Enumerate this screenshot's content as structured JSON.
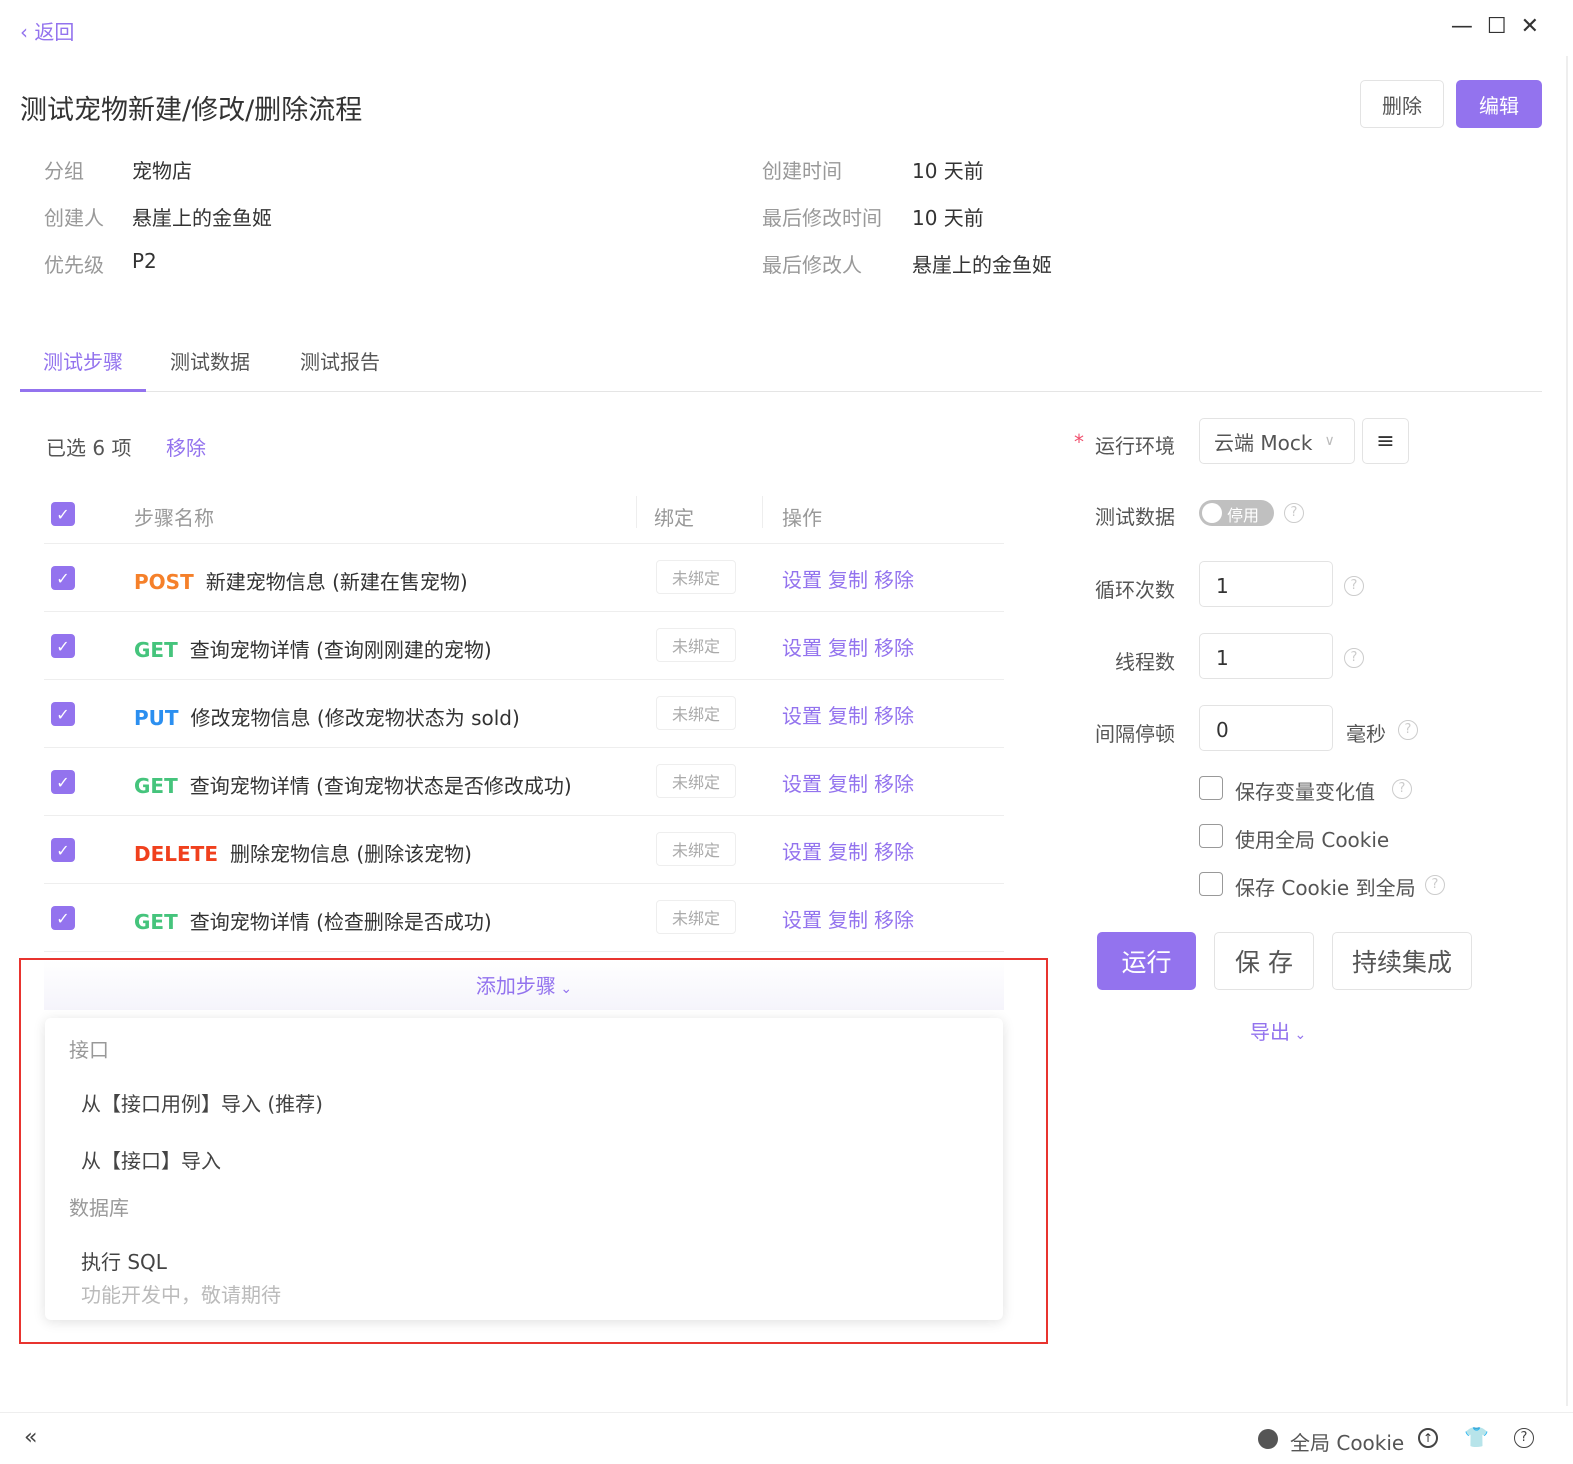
{
  "back_label": "返回",
  "title": "测试宠物新建/修改/删除流程",
  "header_buttons": {
    "delete": "删除",
    "edit": "编辑"
  },
  "meta": {
    "group_label": "分组",
    "group": "宠物店",
    "creator_label": "创建人",
    "creator": "悬崖上的金鱼姬",
    "priority_label": "优先级",
    "priority": "P2",
    "created_label": "创建时间",
    "created": "10 天前",
    "modified_label": "最后修改时间",
    "modified": "10 天前",
    "modifier_label": "最后修改人",
    "modifier": "悬崖上的金鱼姬"
  },
  "tabs": [
    "测试步骤",
    "测试数据",
    "测试报告"
  ],
  "selection": {
    "text": "已选 6 项",
    "remove": "移除"
  },
  "table": {
    "headers": [
      "步骤名称",
      "绑定",
      "操作"
    ],
    "ops": [
      "设置",
      "复制",
      "移除"
    ],
    "rows": [
      {
        "method": "POST",
        "color": "#f5802a",
        "name": "新建宠物信息 (新建在售宠物)",
        "bind": "未绑定"
      },
      {
        "method": "GET",
        "color": "#45c47c",
        "name": "查询宠物详情 (查询刚刚建的宠物)",
        "bind": "未绑定"
      },
      {
        "method": "PUT",
        "color": "#2b8ff0",
        "name": "修改宠物信息 (修改宠物状态为 sold)",
        "bind": "未绑定"
      },
      {
        "method": "GET",
        "color": "#45c47c",
        "name": "查询宠物详情 (查询宠物状态是否修改成功)",
        "bind": "未绑定"
      },
      {
        "method": "DELETE",
        "color": "#f0401d",
        "name": "删除宠物信息 (删除该宠物)",
        "bind": "未绑定"
      },
      {
        "method": "GET",
        "color": "#45c47c",
        "name": "查询宠物详情 (检查删除是否成功)",
        "bind": "未绑定"
      }
    ]
  },
  "add_step": "添加步骤",
  "dropdown": {
    "group1": "接口",
    "item1": "从【接口用例】导入 (推荐)",
    "item2": "从【接口】导入",
    "group2": "数据库",
    "item3": "执行 SQL",
    "item3_sub": "功能开发中，敬请期待"
  },
  "settings": {
    "env_label": "运行环境",
    "env": "云端 Mock",
    "data_label": "测试数据",
    "data_toggle": "停用",
    "loop_label": "循环次数",
    "loop": "1",
    "threads_label": "线程数",
    "threads": "1",
    "interval_label": "间隔停顿",
    "interval": "0",
    "interval_unit": "毫秒",
    "cb1": "保存变量变化值",
    "cb2": "使用全局 Cookie",
    "cb3": "保存 Cookie 到全局"
  },
  "actions": {
    "run": "运行",
    "save": "保 存",
    "ci": "持续集成",
    "export": "导出"
  },
  "footer": {
    "cookie": "全局 Cookie"
  },
  "accent": "#9373ee"
}
